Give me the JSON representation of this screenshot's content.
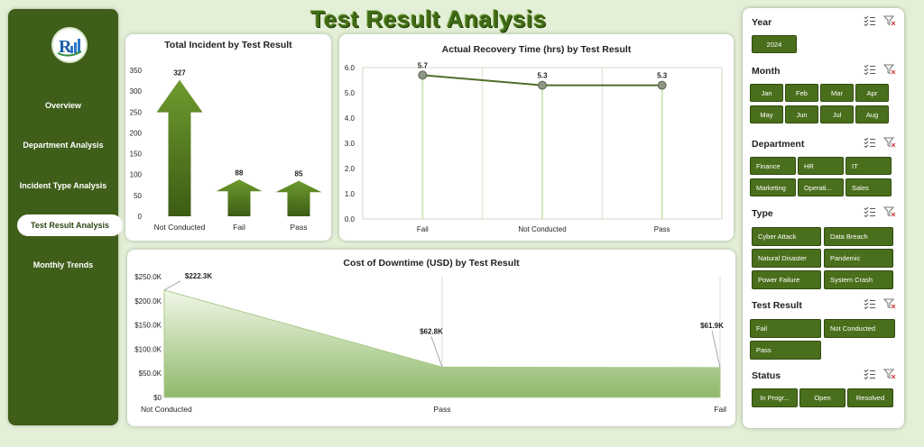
{
  "page_title": "Test Result Analysis",
  "nav": {
    "items": [
      {
        "label": "Overview"
      },
      {
        "label": "Department Analysis"
      },
      {
        "label": "Incident Type Analysis"
      },
      {
        "label": "Test Result Analysis",
        "active": true
      },
      {
        "label": "Monthly Trends"
      }
    ]
  },
  "colors": {
    "sidebar": "#3f5e19",
    "accent": "#4a6f1c",
    "bar_dark": "#3d5c14",
    "bar_light": "#6e9a2e",
    "area_fill": "#8fb96a",
    "line": "#4e6e2a"
  },
  "chart_data": [
    {
      "type": "bar",
      "title": "Total Incident by Test Result",
      "categories": [
        "Not Conducted",
        "Fail",
        "Pass"
      ],
      "values": [
        327,
        88,
        85
      ],
      "data_labels": [
        "327",
        "88",
        "85"
      ],
      "yticks": [
        "0",
        "50",
        "100",
        "150",
        "200",
        "250",
        "300",
        "350"
      ],
      "ylim": [
        0,
        350
      ],
      "mark": "arrow"
    },
    {
      "type": "line",
      "title": "Actual Recovery Time (hrs) by Test Result",
      "categories": [
        "Fail",
        "Not Conducted",
        "Pass"
      ],
      "values": [
        5.7,
        5.3,
        5.3
      ],
      "data_labels": [
        "5.7",
        "5.3",
        "5.3"
      ],
      "yticks": [
        "0.0",
        "1.0",
        "2.0",
        "3.0",
        "4.0",
        "5.0",
        "6.0"
      ],
      "ylim": [
        0,
        6
      ]
    },
    {
      "type": "area",
      "title": "Cost of Downtime (USD) by Test Result",
      "categories": [
        "Not Conducted",
        "Pass",
        "Fail"
      ],
      "values": [
        222300,
        62800,
        61900
      ],
      "data_labels": [
        "$222.3K",
        "$62.8K",
        "$61.9K"
      ],
      "yticks": [
        "$0",
        "$50.0K",
        "$100.0K",
        "$150.0K",
        "$200.0K",
        "$250.0K"
      ],
      "ylim": [
        0,
        250000
      ]
    }
  ],
  "slicers": {
    "year": {
      "title": "Year",
      "items": [
        "2024"
      ]
    },
    "month": {
      "title": "Month",
      "items": [
        "Jan",
        "Feb",
        "Mar",
        "Apr",
        "May",
        "Jun",
        "Jul",
        "Aug"
      ]
    },
    "department": {
      "title": "Department",
      "items": [
        "Finance",
        "HR",
        "IT",
        "Marketing",
        "Operati...",
        "Sales"
      ]
    },
    "type": {
      "title": "Type",
      "items": [
        "Cyber Attack",
        "Data Breach",
        "Natural Disaster",
        "Pandemic",
        "Power Failure",
        "System Crash"
      ]
    },
    "test_result": {
      "title": "Test Result",
      "items": [
        "Fail",
        "Not Conducted",
        "Pass"
      ]
    },
    "status": {
      "title": "Status",
      "items": [
        "In Progr...",
        "Open",
        "Resolved"
      ]
    }
  }
}
